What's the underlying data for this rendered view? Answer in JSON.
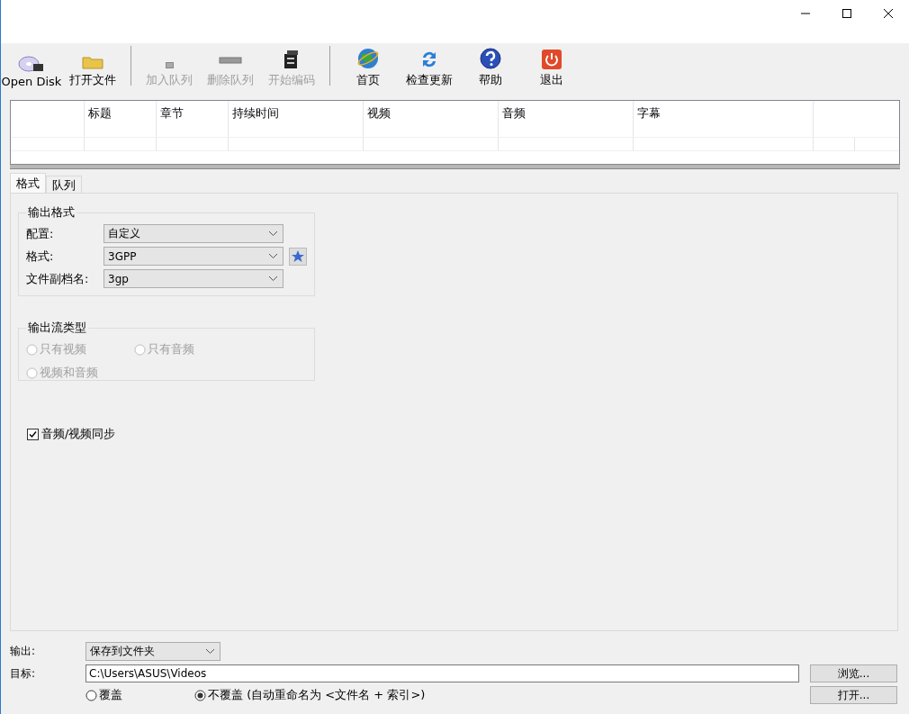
{
  "toolbar": [
    {
      "kind": "button",
      "label": "Open Disk",
      "disabled": false
    },
    {
      "kind": "button",
      "label": "打开文件",
      "disabled": false
    },
    {
      "kind": "separator"
    },
    {
      "kind": "button",
      "label": "加入队列",
      "disabled": true
    },
    {
      "kind": "button",
      "label": "删除队列",
      "disabled": true
    },
    {
      "kind": "button",
      "label": "开始编码",
      "disabled": true
    },
    {
      "kind": "separator"
    },
    {
      "kind": "button",
      "label": "首页",
      "disabled": false
    },
    {
      "kind": "button",
      "label": "检查更新",
      "disabled": false
    },
    {
      "kind": "button",
      "label": "帮助",
      "disabled": false
    },
    {
      "kind": "button",
      "label": "退出",
      "disabled": false
    }
  ],
  "table": {
    "columns": [
      "标题",
      "章节",
      "持续时间",
      "视频",
      "音频",
      "字幕"
    ]
  },
  "tabs": [
    {
      "label": "格式",
      "selected": true
    },
    {
      "label": "队列",
      "selected": false
    }
  ],
  "output_format": {
    "title": "输出格式",
    "fields": [
      {
        "label": "配置:",
        "value": "自定义"
      },
      {
        "label": "格式:",
        "value": "3GPP"
      },
      {
        "label": "文件副档名:",
        "value": "3gp"
      }
    ]
  },
  "stream_type": {
    "title": "输出流类型",
    "options": [
      {
        "label": "只有视频",
        "selected": false,
        "disabled": true
      },
      {
        "label": "只有音频",
        "selected": false,
        "disabled": true
      },
      {
        "label": "视频和音频",
        "selected": false,
        "disabled": true
      }
    ]
  },
  "sync": {
    "label": "音频/视频同步",
    "checked": true
  },
  "output": {
    "label": "输出:",
    "value": "保存到文件夹"
  },
  "target": {
    "label": "目标:",
    "value": "C:\\Users\\ASUS\\Videos"
  },
  "overwrite": [
    {
      "label": "覆盖",
      "selected": false
    },
    {
      "label": "不覆盖 (自动重命名为 <文件名 + 索引>)",
      "selected": true
    }
  ],
  "buttons": [
    "浏览...",
    "打开..."
  ]
}
